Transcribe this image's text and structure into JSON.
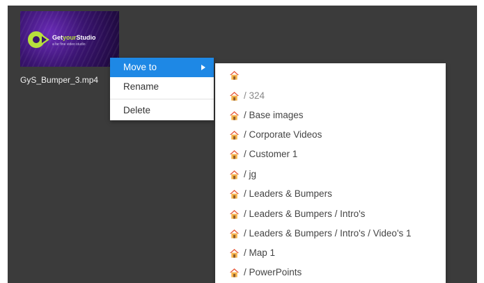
{
  "file": {
    "name": "GyS_Bumper_3.mp4",
    "thumbnail": {
      "brand_prefix": "Get",
      "brand_accent": "your",
      "brand_suffix": "Studio",
      "tagline": "a far fine video studio"
    }
  },
  "context_menu": {
    "items": [
      {
        "label": "Move to",
        "active": true,
        "has_submenu": true
      },
      {
        "label": "Rename"
      },
      {
        "label": "Delete"
      }
    ]
  },
  "move_submenu": {
    "icon": "home-icon",
    "items": [
      {
        "label": ""
      },
      {
        "label": "/ 324"
      },
      {
        "label": "/ Base images"
      },
      {
        "label": "/ Corporate Videos"
      },
      {
        "label": "/ Customer 1"
      },
      {
        "label": "/ jg"
      },
      {
        "label": "/ Leaders & Bumpers"
      },
      {
        "label": "/ Leaders & Bumpers / Intro's"
      },
      {
        "label": "/ Leaders & Bumpers / Intro's / Video's 1"
      },
      {
        "label": "/ Map 1"
      },
      {
        "label": "/ PowerPoints"
      }
    ]
  },
  "colors": {
    "canvas_bg": "#3b3b3b",
    "menu_active": "#1e88e5",
    "house_roof": "#e8583a",
    "house_body": "#f6b24a"
  }
}
